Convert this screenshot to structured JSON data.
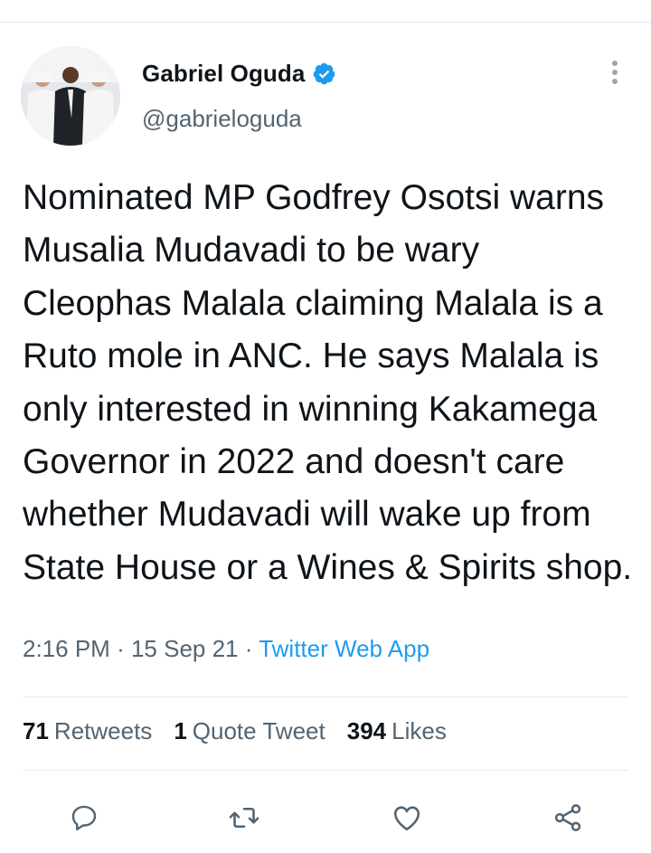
{
  "author": {
    "name": "Gabriel Oguda",
    "handle": "@gabrieloguda",
    "verified": true
  },
  "tweet": {
    "text": "Nominated MP Godfrey Osotsi warns Musalia Mudavadi to be wary Cleophas Malala claiming Malala is a Ruto mole in ANC. He says Malala is only interested in winning Kakamega Governor in 2022 and doesn't care whether Mudavadi will wake up from State House or a Wines & Spirits shop."
  },
  "meta": {
    "time": "2:16 PM",
    "date": "15 Sep 21",
    "dot": "·",
    "source": "Twitter Web App"
  },
  "stats": {
    "retweets_count": "71",
    "retweets_label": "Retweets",
    "quotes_count": "1",
    "quotes_label": "Quote Tweet",
    "likes_count": "394",
    "likes_label": "Likes"
  },
  "actions": [
    "reply-icon",
    "retweet-icon",
    "like-icon",
    "share-icon"
  ],
  "colors": {
    "accent": "#1d9bf0",
    "secondary_text": "#536471",
    "icon": "#536471"
  }
}
